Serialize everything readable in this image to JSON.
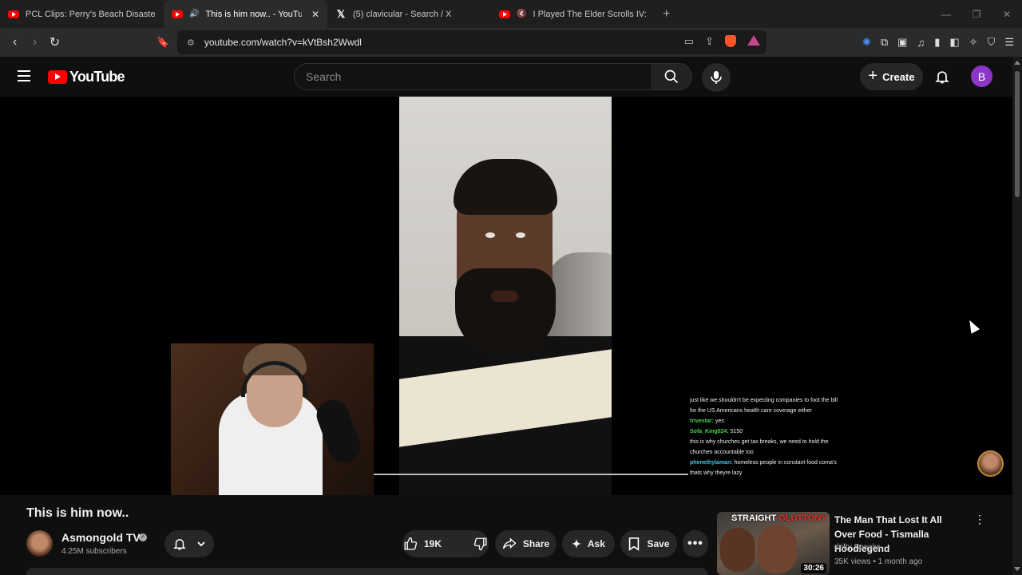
{
  "browser": {
    "tabs": [
      {
        "title": "PCL Clips: Perry's Beach Disaster - Yo",
        "favicon": "youtube-icon",
        "active": false
      },
      {
        "title": "This is him now.. - YouTube",
        "favicon": "youtube-icon",
        "active": true
      },
      {
        "title": "(5) clavicular - Search / X",
        "favicon": "x-icon",
        "active": false
      },
      {
        "title": "I Played The Elder Scrolls IV: Obli",
        "favicon": "youtube-icon",
        "active": false
      }
    ],
    "url": "youtube.com/watch?v=kVtBsh2Wwdl"
  },
  "youtube": {
    "logo_text": "YouTube",
    "search_placeholder": "Search",
    "create_label": "Create",
    "account_initial": "B",
    "accent": "#ff0000",
    "avatar_color": "#8e35c9"
  },
  "chat": [
    {
      "name": "",
      "text": "just like we shouldn't be expecting companies to foot the bill for the US Americans health care coverage either"
    },
    {
      "name": "trivestar:",
      "text": "yes"
    },
    {
      "name": "Sofa_King024:",
      "text": "5150"
    },
    {
      "name": "",
      "text": "this is why churches get tax breaks, we need to hold the churches accountable too"
    },
    {
      "name": "phenethylaman:",
      "text": "homeless people in constant food coma's thats why theyre lazy"
    }
  ],
  "video": {
    "title": "This is him now..",
    "channel": "Asmongold TV",
    "subscribers": "4.25M subscribers",
    "likes": "19K",
    "share_label": "Share",
    "ask_label": "Ask",
    "save_label": "Save"
  },
  "recommendation": {
    "thumb_text_white": "STRAIGHT ",
    "thumb_text_red": "GLUTTONY",
    "duration": "30:26",
    "title": "The Man That Lost It All Over Food - Tismalla  Hoodlegend",
    "channel": "drifty Speaks",
    "meta": "35K views • 1 month ago"
  }
}
